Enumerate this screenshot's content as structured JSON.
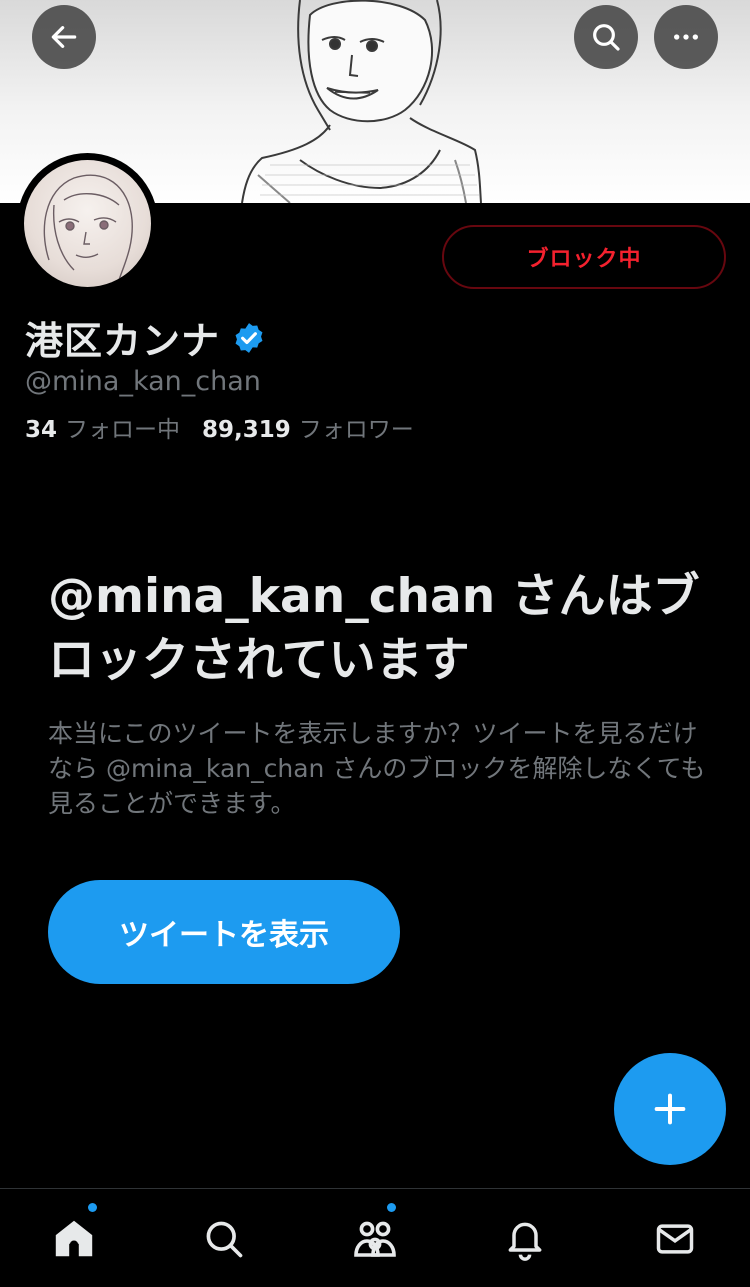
{
  "header": {
    "back_icon": "arrow-left-icon",
    "search_icon": "search-icon",
    "more_icon": "more-horizontal-icon"
  },
  "profile": {
    "display_name": "港区カンナ",
    "verified": true,
    "verified_color": "#1d9bf0",
    "handle": "@mina_kan_chan",
    "following_count": "34",
    "following_label": "フォロー中",
    "followers_count": "89,319",
    "followers_label": "フォロワー",
    "block_button_label": "ブロック中",
    "block_color": "#f4212e"
  },
  "blocked_notice": {
    "title": "@mina_kan_chan さんはブロックされています",
    "description": "本当にこのツイートを表示しますか？ツイートを見るだけなら @mina_kan_chan さんのブロックを解除しなくても見ることができます。",
    "show_tweets_label": "ツイートを表示"
  },
  "fab": {
    "icon": "plus-icon"
  },
  "tabbar": {
    "items": [
      {
        "name": "home",
        "icon": "home-icon",
        "badge": true
      },
      {
        "name": "search",
        "icon": "search-icon",
        "badge": false
      },
      {
        "name": "communities",
        "icon": "communities-icon",
        "badge": true
      },
      {
        "name": "notifications",
        "icon": "bell-icon",
        "badge": false
      },
      {
        "name": "messages",
        "icon": "mail-icon",
        "badge": false
      }
    ]
  },
  "accent_color": "#1d9bf0"
}
